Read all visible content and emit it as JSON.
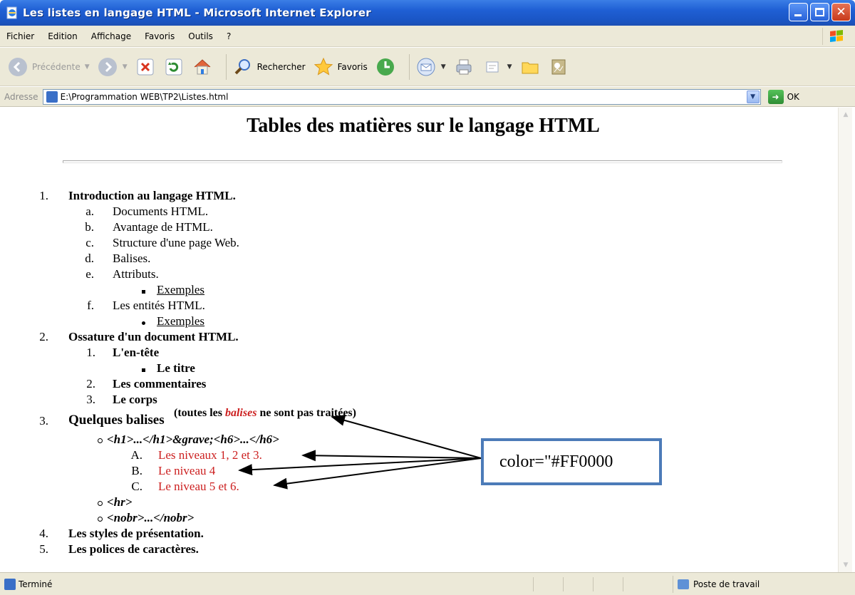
{
  "window": {
    "title": "Les listes en langage HTML - Microsoft Internet Explorer"
  },
  "menu": [
    "Fichier",
    "Edition",
    "Affichage",
    "Favoris",
    "Outils",
    "?"
  ],
  "toolbar": {
    "back_label": "Précédente",
    "search_label": "Rechercher",
    "favorites_label": "Favoris"
  },
  "address": {
    "label": "Adresse",
    "url": "E:\\Programmation WEB\\TP2\\Listes.html",
    "go_label": "OK"
  },
  "page": {
    "title": "Tables des matières sur le langage HTML",
    "items": [
      {
        "num": "1.",
        "text": "Introduction au langage HTML.",
        "sub": [
          {
            "mk": "a.",
            "text": "Documents HTML."
          },
          {
            "mk": "b.",
            "text": "Avantage de HTML."
          },
          {
            "mk": "c.",
            "text": "Structure d'une page Web."
          },
          {
            "mk": "d.",
            "text": "Balises."
          },
          {
            "mk": "e.",
            "text": "Attributs."
          },
          {
            "bullet": "square",
            "text": "Exemples"
          },
          {
            "mk": "f.",
            "text": "Les entités HTML."
          },
          {
            "bullet": "disc",
            "text": "Exemples"
          }
        ]
      },
      {
        "num": "2.",
        "text": "Ossature d'un document HTML.",
        "sub": [
          {
            "mk": "1.",
            "text": "L'en-tête"
          },
          {
            "bullet": "square",
            "text": "Le titre"
          },
          {
            "mk": "2.",
            "text": "Les commentaires"
          },
          {
            "mk": "3.",
            "text": "Le corps"
          }
        ]
      },
      {
        "num": "3.",
        "text": "Quelques balises",
        "sup": {
          "pre": "(toutes les ",
          "em": "balises",
          "post": " ne sont pas traitées)"
        },
        "sub": [
          {
            "bullet": "circle",
            "text": "<h1>...</h1>&grave;<h6>...</h6>"
          },
          {
            "mk": "A.",
            "text": "Les niveaux 1, 2 et 3."
          },
          {
            "mk": "B.",
            "text": "Le niveau 4"
          },
          {
            "mk": "C.",
            "text": "Le niveau 5 et 6."
          },
          {
            "bullet": "circle",
            "text": "<hr>"
          },
          {
            "bullet": "circle",
            "text": "<nobr>...</nobr>"
          }
        ]
      },
      {
        "num": "4.",
        "text": "Les styles de présentation."
      },
      {
        "num": "5.",
        "text": "Les polices de caractères."
      }
    ],
    "callout": "color=\"#FF0000",
    "accent_red": "#cc1f1f"
  },
  "status": {
    "text": "Terminé",
    "zone": "Poste de travail"
  }
}
